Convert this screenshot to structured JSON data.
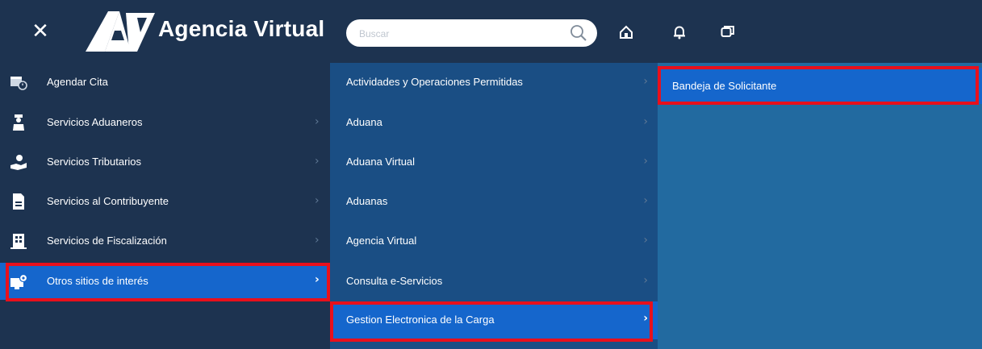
{
  "header": {
    "brand": "Agencia Virtual",
    "close_icon": "close-icon",
    "search_placeholder": "Buscar",
    "icons": [
      "search-icon",
      "home-icon",
      "bell-icon",
      "chat-icon"
    ]
  },
  "menu": {
    "col1": [
      {
        "label": "Agendar Cita",
        "icon": "calendar-clock-icon",
        "chevron": false
      },
      {
        "label": "Servicios Aduaneros",
        "icon": "officer-icon",
        "chevron": true
      },
      {
        "label": "Servicios Tributarios",
        "icon": "hand-coin-icon",
        "chevron": true
      },
      {
        "label": "Servicios al Contribuyente",
        "icon": "document-icon",
        "chevron": true
      },
      {
        "label": "Servicios de Fiscalización",
        "icon": "building-icon",
        "chevron": true
      },
      {
        "label": "Otros sitios de interés",
        "icon": "monitor-pin-icon",
        "chevron": true,
        "selected": true
      }
    ],
    "col2": [
      {
        "label": "Actividades y Operaciones Permitidas",
        "chevron": true
      },
      {
        "label": "Aduana",
        "chevron": true
      },
      {
        "label": "Aduana Virtual",
        "chevron": true
      },
      {
        "label": "Aduanas",
        "chevron": true
      },
      {
        "label": "Agencia Virtual",
        "chevron": true
      },
      {
        "label": "Consulta e-Servicios",
        "chevron": true
      },
      {
        "label": "Gestion Electronica de la Carga",
        "chevron": true,
        "selected": true
      }
    ],
    "col3": [
      {
        "label": "Bandeja de Solicitante",
        "selected": true
      }
    ]
  },
  "colors": {
    "header_bg": "#1d3350",
    "col2_bg": "#1a4e84",
    "col3_bg": "#226aa0",
    "selected_bg": "#1566cc",
    "highlight": "#e8101c"
  }
}
